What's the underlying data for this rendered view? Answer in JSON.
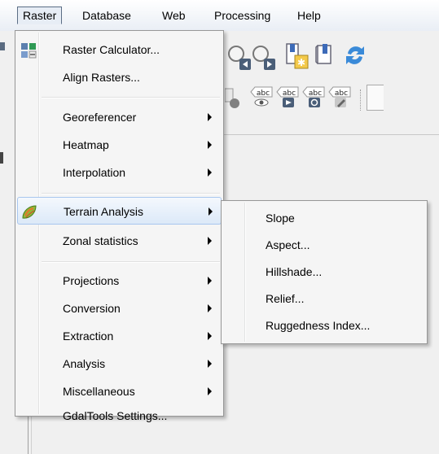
{
  "menubar": {
    "items": [
      "Raster",
      "Database",
      "Web",
      "Processing",
      "Help"
    ]
  },
  "raster_menu": {
    "items": [
      {
        "label": "Raster Calculator...",
        "submenu": false,
        "icon": "raster-calculator-icon"
      },
      {
        "label": "Align Rasters...",
        "submenu": false
      },
      {
        "label": "Georeferencer",
        "submenu": true
      },
      {
        "label": "Heatmap",
        "submenu": true
      },
      {
        "label": "Interpolation",
        "submenu": true
      },
      {
        "label": "Terrain Analysis",
        "submenu": true,
        "highlighted": true,
        "icon": "terrain-analysis-icon"
      },
      {
        "label": "Zonal statistics",
        "submenu": true
      },
      {
        "label": "Projections",
        "submenu": true
      },
      {
        "label": "Conversion",
        "submenu": true
      },
      {
        "label": "Extraction",
        "submenu": true
      },
      {
        "label": "Analysis",
        "submenu": true
      },
      {
        "label": "Miscellaneous",
        "submenu": true
      },
      {
        "label": "GdalTools Settings...",
        "submenu": false
      }
    ]
  },
  "terrain_submenu": {
    "items": [
      "Slope",
      "Aspect...",
      "Hillshade...",
      "Relief...",
      "Ruggedness Index..."
    ]
  },
  "toolbar_icons": {
    "row1": [
      "zoom-to-previous-icon",
      "zoom-to-next-icon",
      "new-bookmark-icon",
      "show-bookmarks-icon",
      "refresh-icon"
    ],
    "row2": [
      "pin-labels-icon",
      "show-hide-labels-icon",
      "move-label-icon",
      "rotate-label-icon",
      "change-label-icon"
    ],
    "label_icon_text": "abc"
  },
  "colors": {
    "highlight_border": "#a8c6ee",
    "highlight_fill": "#dce9f8",
    "menu_bg": "#f5f5f5"
  }
}
